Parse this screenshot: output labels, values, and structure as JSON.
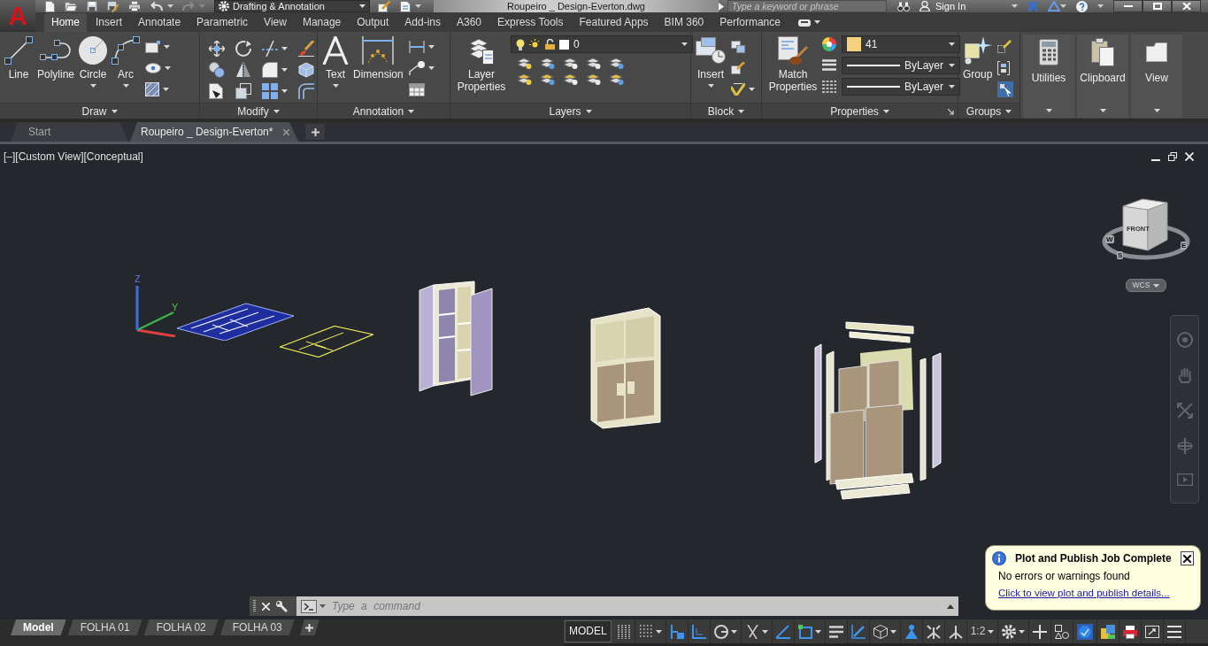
{
  "app_menu": {
    "label": "A"
  },
  "title_bar": {
    "workspace": "Drafting & Annotation",
    "file_title": "Roupeiro _ Design-Everton.dwg",
    "search": {
      "placeholder": "Type a keyword or phrase"
    },
    "sign_in": "Sign In"
  },
  "ribbon_tabs": [
    {
      "label": "Home",
      "selected": true
    },
    {
      "label": "Insert",
      "selected": false
    },
    {
      "label": "Annotate",
      "selected": false
    },
    {
      "label": "Parametric",
      "selected": false
    },
    {
      "label": "View",
      "selected": false
    },
    {
      "label": "Manage",
      "selected": false
    },
    {
      "label": "Output",
      "selected": false
    },
    {
      "label": "Add-ins",
      "selected": false
    },
    {
      "label": "A360",
      "selected": false
    },
    {
      "label": "Express Tools",
      "selected": false
    },
    {
      "label": "Featured Apps",
      "selected": false
    },
    {
      "label": "BIM 360",
      "selected": false
    },
    {
      "label": "Performance",
      "selected": false
    }
  ],
  "ribbon_panels": [
    {
      "kind": "draw",
      "title": "Draw",
      "buttons": [
        {
          "label": "Line",
          "has_menu": false
        },
        {
          "label": "Polyline",
          "has_menu": false
        },
        {
          "label": "Circle",
          "has_menu": true
        },
        {
          "label": "Arc",
          "has_menu": true
        }
      ]
    },
    {
      "kind": "modify",
      "title": "Modify"
    },
    {
      "kind": "annotation",
      "title": "Annotation",
      "buttons": [
        {
          "label": "Text",
          "has_menu": true
        },
        {
          "label": "Dimension",
          "has_menu": false
        }
      ]
    },
    {
      "kind": "layers",
      "title": "Layers",
      "buttons": [
        {
          "label": "Layer Properties",
          "has_menu": false
        }
      ],
      "layer": "0"
    },
    {
      "kind": "block",
      "title": "Block",
      "buttons": [
        {
          "label": "Insert",
          "has_menu": true
        }
      ]
    },
    {
      "kind": "properties",
      "title": "Properties",
      "buttons": [
        {
          "label": "Match Properties",
          "has_menu": false
        }
      ],
      "color": {
        "value": "41",
        "color": "#f7d27e"
      },
      "lineweight": "ByLayer",
      "linetype": "ByLayer"
    },
    {
      "kind": "groups",
      "title": "Groups",
      "buttons": [
        {
          "label": "Group",
          "has_menu": false
        }
      ]
    },
    {
      "kind": "launcher",
      "title": "Utilities"
    },
    {
      "kind": "launcher",
      "title": "Clipboard"
    },
    {
      "kind": "launcher",
      "title": "View"
    }
  ],
  "document_tabs": [
    {
      "label": "Start",
      "selected": false
    },
    {
      "label": "Roupeiro _ Design-Everton*",
      "selected": true
    }
  ],
  "viewport": {
    "label": "[–][Custom View][Conceptual]",
    "ucs_labels": [
      "Z",
      "Y"
    ],
    "viewcube": {
      "face": "FRONT",
      "compass": [
        "W",
        "S",
        "E"
      ]
    },
    "coordinate_system": "WCS"
  },
  "command_line": {
    "placeholder": "Type a command"
  },
  "notification": {
    "title": "Plot and Publish Job Complete",
    "message": "No errors or warnings found",
    "link": "Click to view plot and publish details..."
  },
  "layout_tabs": [
    {
      "label": "Model",
      "selected": true
    },
    {
      "label": "FOLHA 01",
      "selected": false
    },
    {
      "label": "FOLHA 02",
      "selected": false
    },
    {
      "label": "FOLHA 03",
      "selected": false
    }
  ],
  "status_bar": {
    "space": "MODEL",
    "items": [
      {
        "kind": "toggle",
        "on": false,
        "menu": false
      },
      {
        "kind": "toggle",
        "on": false,
        "menu": true
      },
      {
        "kind": "toggle",
        "on": true,
        "menu": false
      },
      {
        "kind": "toggle",
        "on": true,
        "menu": false
      },
      {
        "kind": "toggle",
        "on": false,
        "menu": true
      },
      {
        "kind": "toggle",
        "on": false,
        "menu": true
      },
      {
        "kind": "toggle",
        "on": true,
        "menu": false
      },
      {
        "kind": "toggle",
        "on": true,
        "menu": true
      },
      {
        "kind": "toggle",
        "on": false,
        "menu": false
      },
      {
        "kind": "toggle",
        "on": true,
        "menu": false
      },
      {
        "kind": "toggle",
        "on": false,
        "menu": true
      },
      {
        "kind": "toggle",
        "on": true,
        "menu": false
      },
      {
        "kind": "toggle",
        "on": false,
        "menu": false
      },
      {
        "kind": "toggle",
        "on": false,
        "menu": false
      },
      {
        "kind": "scale",
        "text": "1:2",
        "menu": true
      },
      {
        "kind": "tool",
        "menu": true
      },
      {
        "kind": "tool",
        "menu": false
      },
      {
        "kind": "tool",
        "menu": false
      },
      {
        "kind": "tool",
        "menu": false
      },
      {
        "kind": "tool",
        "menu": false
      },
      {
        "kind": "tool",
        "menu": false
      },
      {
        "kind": "tool",
        "menu": false
      },
      {
        "kind": "tool",
        "menu": false
      }
    ]
  }
}
